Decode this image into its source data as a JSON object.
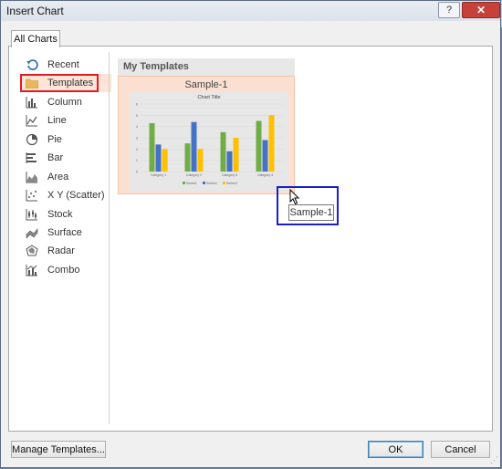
{
  "window": {
    "title": "Insert Chart",
    "help_label": "?",
    "close_label": "✕"
  },
  "tabs": [
    {
      "label": "All Charts"
    }
  ],
  "chart_types": [
    {
      "label": "Recent",
      "icon": "recent-icon"
    },
    {
      "label": "Templates",
      "icon": "folder-icon"
    },
    {
      "label": "Column",
      "icon": "column-chart-icon"
    },
    {
      "label": "Line",
      "icon": "line-chart-icon"
    },
    {
      "label": "Pie",
      "icon": "pie-chart-icon"
    },
    {
      "label": "Bar",
      "icon": "bar-chart-icon"
    },
    {
      "label": "Area",
      "icon": "area-chart-icon"
    },
    {
      "label": "X Y (Scatter)",
      "icon": "scatter-chart-icon"
    },
    {
      "label": "Stock",
      "icon": "stock-chart-icon"
    },
    {
      "label": "Surface",
      "icon": "surface-chart-icon"
    },
    {
      "label": "Radar",
      "icon": "radar-chart-icon"
    },
    {
      "label": "Combo",
      "icon": "combo-chart-icon"
    }
  ],
  "selected_type": "Templates",
  "templates": {
    "header": "My Templates",
    "items": [
      {
        "name": "Sample-1"
      }
    ],
    "tooltip": "Sample-1"
  },
  "buttons": {
    "manage": "Manage Templates...",
    "ok": "OK",
    "cancel": "Cancel"
  },
  "colors": {
    "series1": "#70ad47",
    "series2": "#4472c4",
    "series3": "#ffc000",
    "highlight": "#fce4d6",
    "red_box": "#e01b24",
    "blue_box": "#1b1ec8"
  },
  "chart_data": {
    "type": "bar",
    "title": "Chart Title",
    "categories": [
      "Category 1",
      "Category 2",
      "Category 3",
      "Category 4"
    ],
    "series": [
      {
        "name": "Series1",
        "values": [
          4.3,
          2.5,
          3.5,
          4.5
        ]
      },
      {
        "name": "Series2",
        "values": [
          2.4,
          4.4,
          1.8,
          2.8
        ]
      },
      {
        "name": "Series3",
        "values": [
          2.0,
          2.0,
          3.0,
          5.0
        ]
      }
    ],
    "ylim": [
      0,
      6
    ],
    "yticks": [
      "0",
      "1",
      "2",
      "3",
      "4",
      "5",
      "6"
    ]
  }
}
